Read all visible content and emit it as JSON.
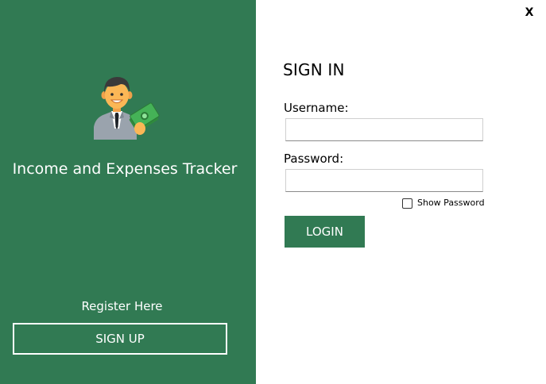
{
  "window": {
    "close_label": "X"
  },
  "branding": {
    "app_title": "Income and Expenses Tracker",
    "logo_icon": "businessman-with-money-icon"
  },
  "register": {
    "label": "Register Here",
    "signup_label": "SIGN UP"
  },
  "signin": {
    "title": "SIGN IN",
    "username_label": "Username:",
    "username_value": "",
    "password_label": "Password:",
    "password_value": "",
    "show_password_label": "Show Password",
    "show_password_checked": false,
    "login_label": "LOGIN"
  },
  "colors": {
    "primary_green": "#317a53",
    "background": "#ffffff",
    "text": "#000000"
  }
}
